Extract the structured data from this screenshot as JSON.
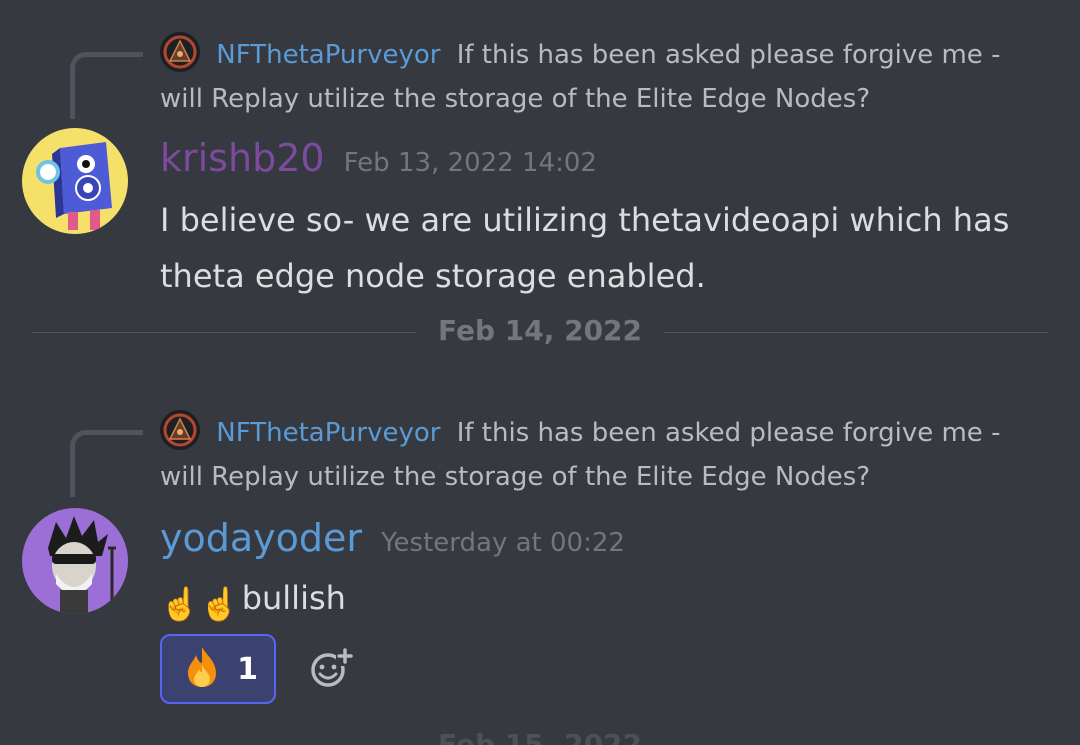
{
  "messages": [
    {
      "reply_author": "NFThetaPurveyor",
      "reply_text": "If this has been asked please forgive me - will Replay utilize the storage of the Elite Edge Nodes?",
      "author": "krishb20",
      "timestamp": "Feb 13, 2022 14:02",
      "body": "I believe so- we are utilizing thetavideoapi which has theta edge node storage enabled.",
      "author_color": "#7c4b9e"
    },
    {
      "reply_author": "NFThetaPurveyor",
      "reply_text": "If this has been asked please forgive me - will Replay utilize the storage of the Elite Edge Nodes?",
      "author": "yodayoder",
      "timestamp": "Yesterday at 00:22",
      "emoji_prefix": "☝️☝️",
      "body": "bullish",
      "author_color": "#5b9bd5",
      "reaction": {
        "emoji": "🔥",
        "count": "1"
      }
    }
  ],
  "dividers": [
    "Feb 14, 2022"
  ],
  "next_divider_partial": "Feb 15, 2022",
  "colors": {
    "background": "#36393f",
    "reaction_border": "#5865f2",
    "reaction_bg": "#3c4270"
  }
}
